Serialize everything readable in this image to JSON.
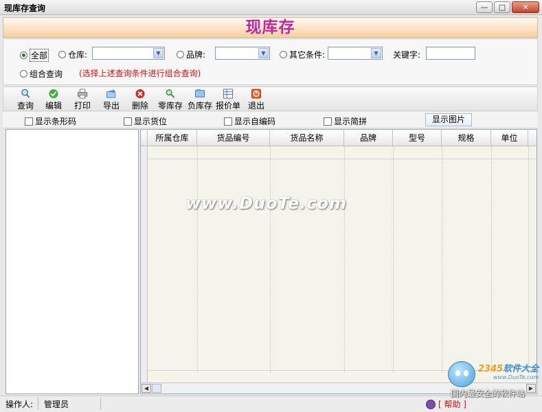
{
  "window": {
    "title": "现库存查询",
    "buttons": {
      "minimize": "—",
      "maximize": "□",
      "close": "✕"
    }
  },
  "banner": {
    "title": "现库存"
  },
  "filters": {
    "radio_all": "全部",
    "radio_warehouse": "仓库:",
    "radio_brand": "品牌:",
    "radio_other": "其它条件:",
    "keyword_label": "关键字:",
    "radio_combo": "组合查询",
    "hint": "(选择上述查询条件进行组合查询)",
    "selected": "all"
  },
  "toolbar": {
    "items": [
      {
        "label": "查询",
        "icon": "search-icon",
        "color": "#3a6fb5"
      },
      {
        "label": "编辑",
        "icon": "check-icon",
        "color": "#2f9e2f"
      },
      {
        "label": "打印",
        "icon": "printer-icon",
        "color": "#777777"
      },
      {
        "label": "导出",
        "icon": "export-icon",
        "color": "#4a86c8"
      },
      {
        "label": "删除",
        "icon": "delete-icon",
        "color": "#d02020"
      },
      {
        "label": "零库存",
        "icon": "zero-stock-icon",
        "color": "#3a8a3a"
      },
      {
        "label": "负库存",
        "icon": "negative-stock-icon",
        "color": "#3a6fb5"
      },
      {
        "label": "报价单",
        "icon": "quote-sheet-icon",
        "color": "#4a6fb0"
      },
      {
        "label": "退出",
        "icon": "exit-icon",
        "color": "#e0501a"
      }
    ]
  },
  "options": {
    "show_barcode": "显示条形码",
    "show_location": "显示货位",
    "show_custom_code": "显示自编码",
    "show_pinyin": "显示简拼",
    "show_image_button": "显示图片"
  },
  "grid": {
    "columns": [
      "所属仓库",
      "货品编号",
      "货品名称",
      "品牌",
      "型号",
      "规格",
      "单位"
    ]
  },
  "watermark": "www.DuoTe.com",
  "status": {
    "operator_label": "操作人:",
    "operator": "管理员",
    "help": "[ 帮助 ]"
  },
  "logo": {
    "brand_a": "2345",
    "brand_b": "软件大全",
    "site": "www.DuoTe.com",
    "slogan": "国内最安全的软件站"
  }
}
